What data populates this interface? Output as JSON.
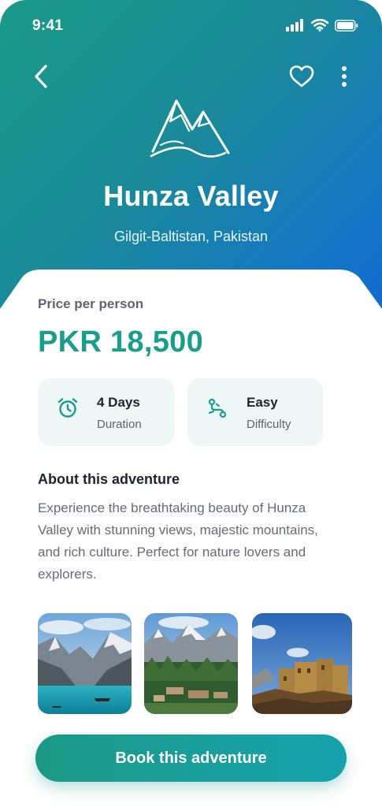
{
  "status_bar": {
    "time": "9:41"
  },
  "destination": {
    "title": "Hunza Valley",
    "location": "Gilgit-Baltistan, Pakistan"
  },
  "price": {
    "label": "Price per person",
    "value": "PKR 18,500"
  },
  "info": {
    "duration": {
      "value": "4 Days",
      "label": "Duration",
      "icon": "alarm-clock-icon"
    },
    "difficulty": {
      "value": "Easy",
      "label": "Difficulty",
      "icon": "hiking-route-icon"
    }
  },
  "about": {
    "title": "About this adventure",
    "text": "Experience the breathtaking beauty of Hunza Valley with stunning views, majestic mountains, and rich culture. Perfect for nature lovers and explorers."
  },
  "gallery": [
    {
      "name": "lake-mountains-photo"
    },
    {
      "name": "valley-village-photo"
    },
    {
      "name": "fort-photo"
    }
  ],
  "cta": {
    "label": "Book this adventure"
  },
  "colors": {
    "accent": "#1a9e8c",
    "hero_start": "#1a9a86",
    "hero_end": "#1268d0",
    "info_bg": "#eef6f6"
  }
}
